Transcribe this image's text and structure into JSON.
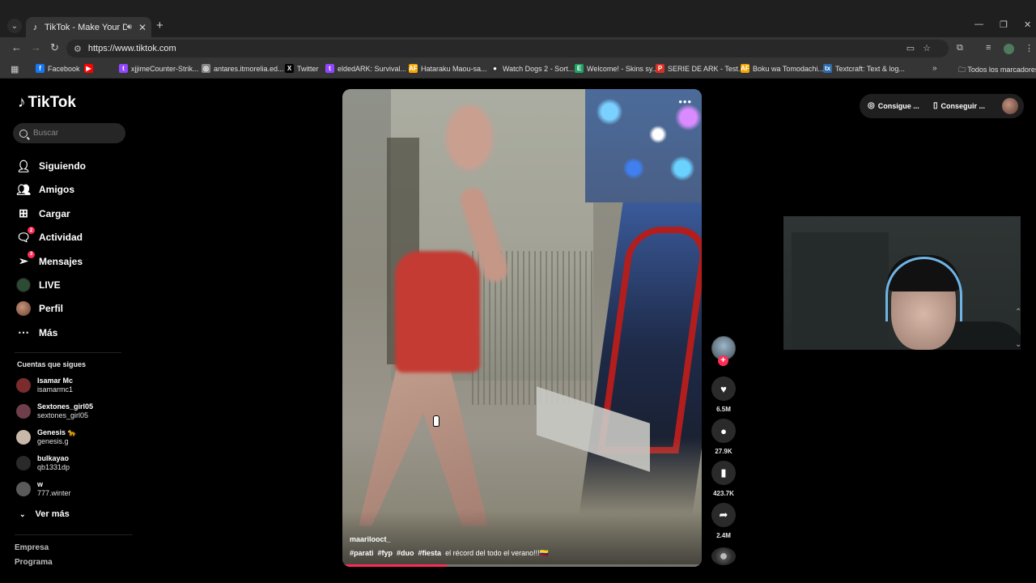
{
  "browser": {
    "tab_title": "TikTok - Make Your Day",
    "url": "https://www.tiktok.com",
    "bookmarks": [
      {
        "label": "Facebook",
        "color": "#1877f2",
        "glyph": "f"
      },
      {
        "label": "",
        "color": "#ff0000",
        "glyph": "▶"
      },
      {
        "label": "xjjimeCounter-Strik...",
        "color": "#9146ff",
        "glyph": "t"
      },
      {
        "label": "antares.itmorelia.ed...",
        "color": "#888888",
        "glyph": "◎"
      },
      {
        "label": "Twitter",
        "color": "#000000",
        "glyph": "X"
      },
      {
        "label": "eldedARK: Survival...",
        "color": "#9146ff",
        "glyph": "t"
      },
      {
        "label": "Hataraku Maou-sa...",
        "color": "#f7a600",
        "glyph": "AF"
      },
      {
        "label": "Watch Dogs 2 - Sort...",
        "color": "#333333",
        "glyph": "●"
      },
      {
        "label": "Welcome! - Skins sy...",
        "color": "#21a366",
        "glyph": "E"
      },
      {
        "label": "SERIE DE ARK - Test...",
        "color": "#d93025",
        "glyph": "P"
      },
      {
        "label": "Boku wa Tomodachi...",
        "color": "#f7a600",
        "glyph": "AF"
      },
      {
        "label": "Textcraft: Text & log...",
        "color": "#2b6cb0",
        "glyph": "tx"
      }
    ],
    "all_bookmarks": "Todos los marcadores"
  },
  "sidebar": {
    "brand": "TikTok",
    "search_placeholder": "Buscar",
    "nav": [
      {
        "label": "Siguiendo",
        "icon": "user-follow-icon"
      },
      {
        "label": "Amigos",
        "icon": "friends-icon"
      },
      {
        "label": "Cargar",
        "icon": "upload-icon"
      },
      {
        "label": "Actividad",
        "icon": "activity-icon",
        "badge": "2"
      },
      {
        "label": "Mensajes",
        "icon": "messages-icon",
        "badge": "3"
      },
      {
        "label": "LIVE",
        "icon": "live-icon"
      },
      {
        "label": "Perfil",
        "icon": "profile-icon"
      },
      {
        "label": "Más",
        "icon": "more-icon"
      }
    ],
    "following_title": "Cuentas que sigues",
    "following": [
      {
        "name": "Isamar Mc",
        "user": "isamarmc1",
        "color": "#7a2b2b"
      },
      {
        "name": "Sextones_girl05",
        "user": "sextones_girl05",
        "color": "#6e3f4a"
      },
      {
        "name": "Genesis 🐆",
        "user": "genesis.g",
        "color": "#c8b8a8"
      },
      {
        "name": "bulkayao",
        "user": "qb1331dp",
        "color": "#2a2a2a"
      },
      {
        "name": "w",
        "user": "777.winter",
        "color": "#5a5a5a"
      }
    ],
    "see_more": "Ver más",
    "footer": [
      "Empresa",
      "Programa"
    ]
  },
  "video": {
    "author": "maarilooct_",
    "hashtags": [
      "#parati",
      "#fyp",
      "#duo",
      "#fiesta"
    ],
    "caption": "el récord del todo el verano!!!🇨🇴",
    "progress": 0.29
  },
  "actions": {
    "likes": "6.5M",
    "comments": "27.9K",
    "saves": "423.7K",
    "shares": "2.4M"
  },
  "top_right": {
    "get_app_1": "Consigue ...",
    "get_app_2": "Conseguir ..."
  }
}
